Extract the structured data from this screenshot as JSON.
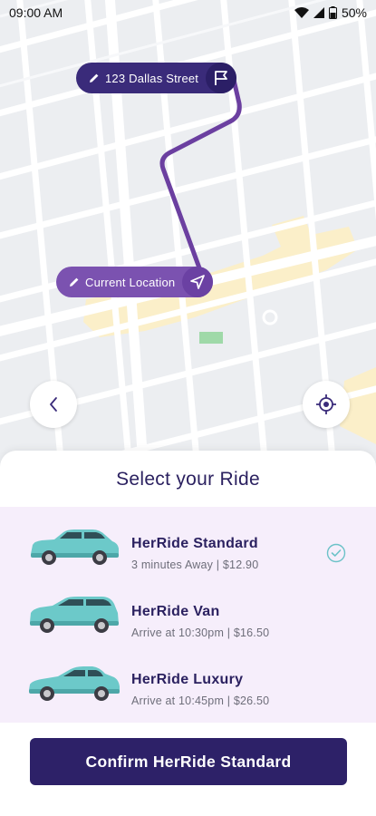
{
  "status_bar": {
    "time": "09:00 AM",
    "battery": "50%"
  },
  "map": {
    "destination": "123 Dallas Street",
    "origin": "Current Location",
    "route_color": "#6b3fa0"
  },
  "sheet": {
    "title": "Select your Ride",
    "rides": [
      {
        "name": "HerRide Standard",
        "detail": "3 minutes Away | $12.90",
        "selected": true,
        "car_icon": "suv-car-icon"
      },
      {
        "name": "HerRide Van",
        "detail": "Arrive at 10:30pm | $16.50",
        "selected": false,
        "car_icon": "van-car-icon"
      },
      {
        "name": "HerRide Luxury",
        "detail": "Arrive at 10:45pm | $26.50",
        "selected": false,
        "car_icon": "sedan-car-icon"
      }
    ],
    "confirm_label": "Confirm HerRide Standard"
  },
  "colors": {
    "brand_dark": "#2d2168",
    "brand_purple": "#7b52b0",
    "list_bg": "#f6eefb",
    "car_teal": "#6cc9c9"
  }
}
